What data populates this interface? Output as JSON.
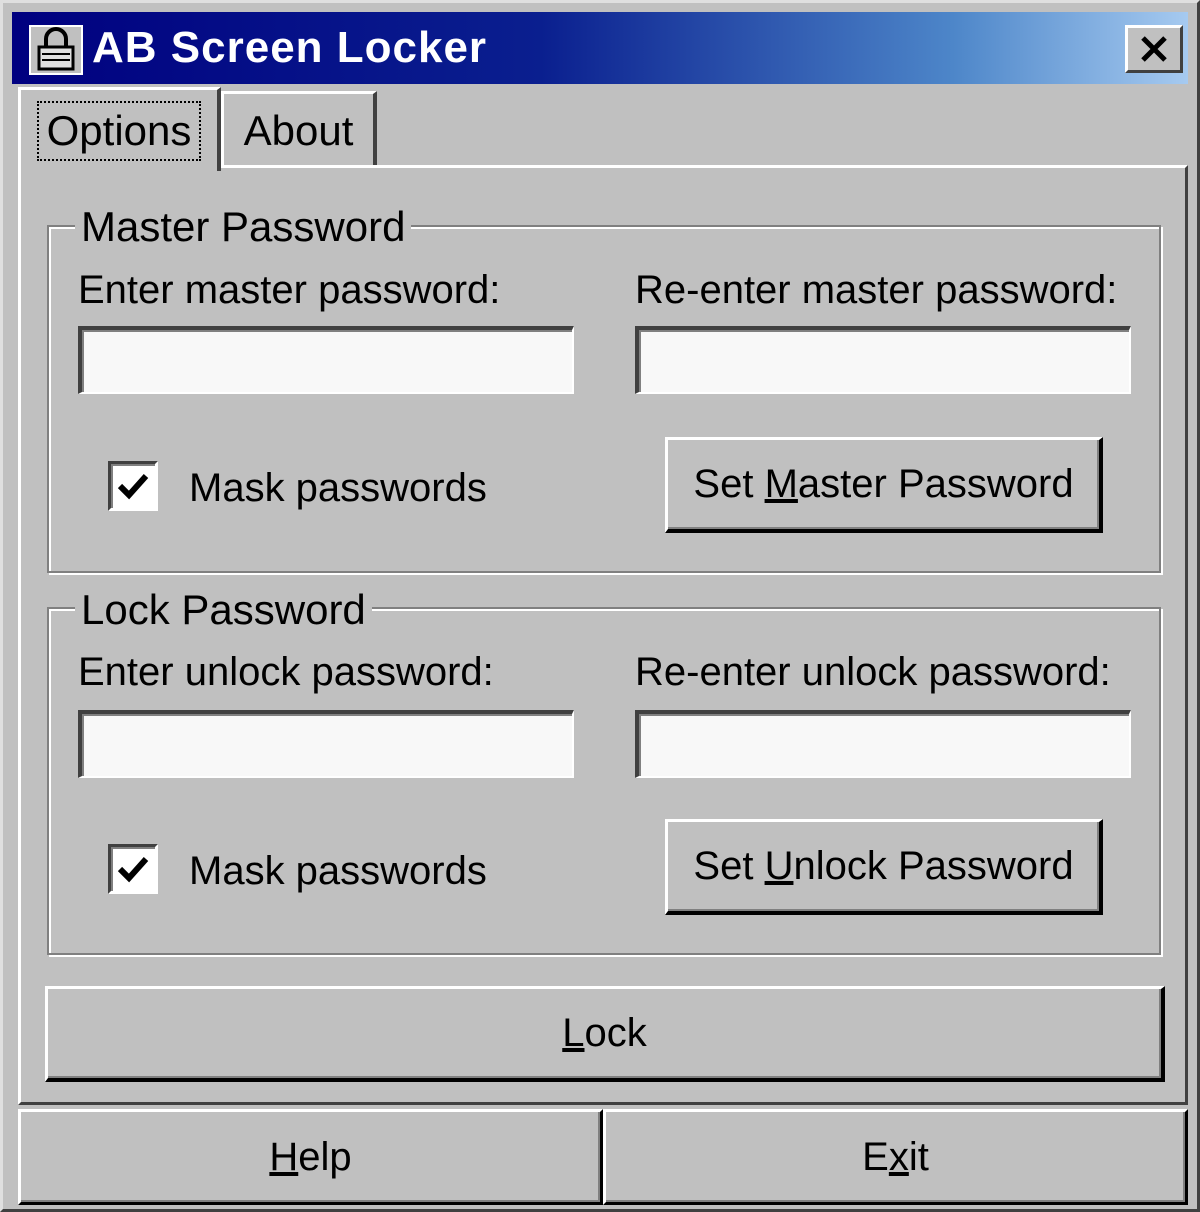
{
  "window": {
    "title": "AB Screen Locker",
    "close_label": "✕"
  },
  "tabs": [
    {
      "label": "Options",
      "selected": true
    },
    {
      "label": "About",
      "selected": false
    }
  ],
  "master_group": {
    "legend": "Master Password",
    "enter_label": "Enter master password:",
    "reenter_label": "Re-enter master password:",
    "enter_value": "",
    "reenter_value": "",
    "mask_label": "Mask passwords",
    "mask_checked": true,
    "set_button": {
      "pre": "Set ",
      "accel": "M",
      "post": "aster Password"
    }
  },
  "lock_group": {
    "legend": "Lock Password",
    "enter_label": "Enter unlock password:",
    "reenter_label": "Re-enter unlock password:",
    "enter_value": "",
    "reenter_value": "",
    "mask_label": "Mask passwords",
    "mask_checked": true,
    "set_button": {
      "pre": "Set ",
      "accel": "U",
      "post": "nlock Password"
    }
  },
  "lock_button": {
    "accel": "L",
    "post": "ock"
  },
  "help_button": {
    "accel": "H",
    "post": "elp"
  },
  "exit_button": {
    "pre": "E",
    "accel": "x",
    "post": "it"
  },
  "icons": {
    "app_icon": "padlock-icon",
    "close_icon": "close-icon",
    "check_icon": "checkmark-icon"
  },
  "colors": {
    "face": "#c0c0c0",
    "titlebar_start": "#000080",
    "titlebar_end": "#a6caf0",
    "field_bg": "#f8f8f8"
  }
}
